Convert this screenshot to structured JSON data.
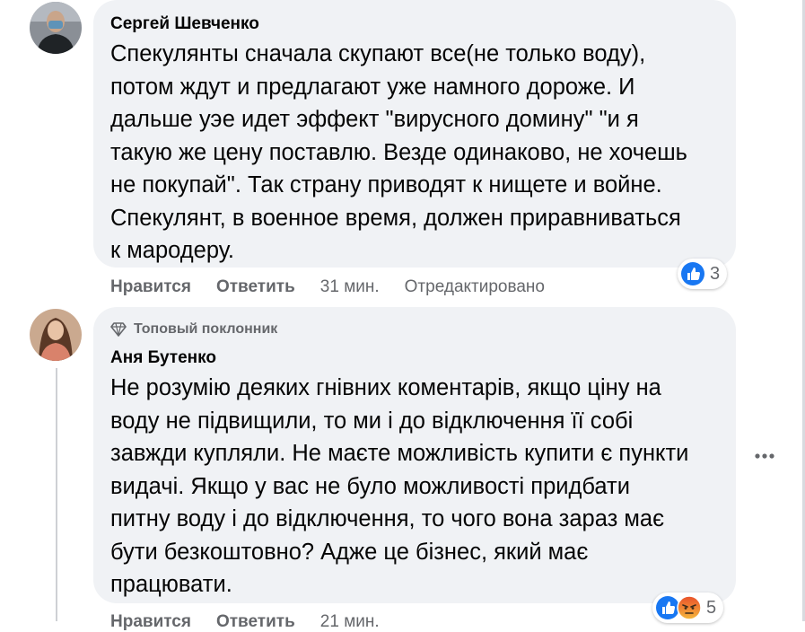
{
  "comments": [
    {
      "author": "Сергей Шевченко",
      "text_lines": [
        "Спекулянты сначала скупают все(не только воду),",
        "потом ждут и предлагают уже намного дороже. И",
        "дальше уэе идет эффект \"вирусного домину\" \"и я",
        "такую же цену поставлю. Везде одинаково, не хочешь",
        "не покупай\". Так страну приводят к нищете и войне.",
        "Спекулянт, в военное время, должен приравниваться",
        "к мародеру."
      ],
      "like_label": "Нравится",
      "reply_label": "Ответить",
      "time": "31 мин.",
      "edited": "Отредактировано",
      "reaction_count": "3",
      "reaction_icons": [
        "like-icon"
      ]
    },
    {
      "badge": "Топовый поклонник",
      "badge_icon": "diamond-icon",
      "author": "Аня Бутенко",
      "text_lines": [
        "Не розумію деяких гнівних коментарів, якщо ціну на",
        "воду не підвищили, то ми і до відключення її собі",
        "завжди купляли. Не маєте можливість купити є пункти",
        "видачі. Якщо у вас не було можливості придбати",
        "питну воду і до відключення, то чого вона зараз має",
        "бути безкоштовно? Адже це бізнес, який має",
        "працювати."
      ],
      "like_label": "Нравится",
      "reply_label": "Ответить",
      "time": "21 мин.",
      "reaction_count": "5",
      "reaction_icons": [
        "like-icon",
        "angry-icon"
      ]
    }
  ],
  "colors": {
    "bubble": "#f0f2f5",
    "secondary_text": "#65676b",
    "like_blue": "#1877f2",
    "angry_orange": "#e9710f"
  },
  "more_icon": "more-options-icon"
}
